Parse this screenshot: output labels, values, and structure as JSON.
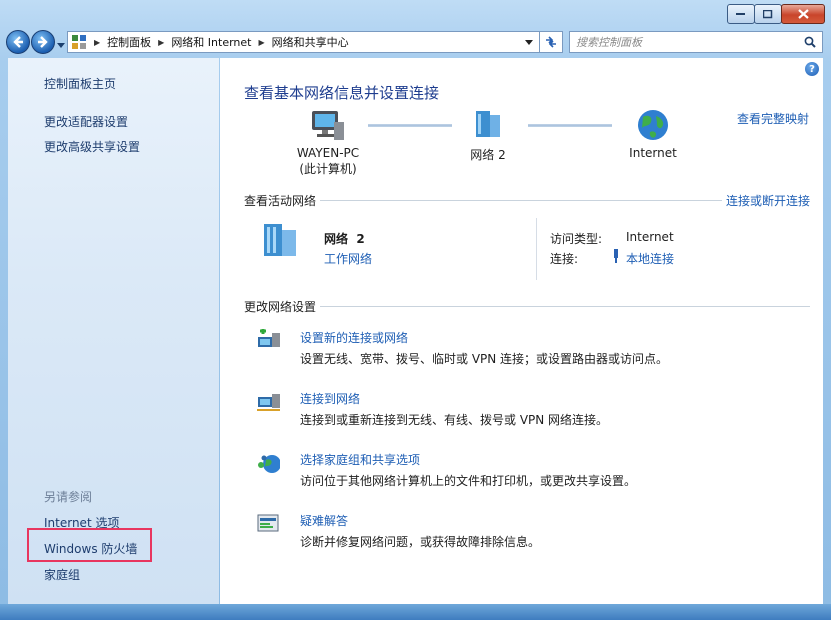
{
  "window": {
    "minimize_label": "Minimize",
    "maximize_label": "Maximize",
    "close_label": "Close"
  },
  "address": {
    "breadcrumbs": [
      "控制面板",
      "网络和 Internet",
      "网络和共享中心"
    ],
    "search_placeholder": "搜索控制面板"
  },
  "sidebar": {
    "items": [
      {
        "label": "控制面板主页"
      },
      {
        "label": "更改适配器设置"
      },
      {
        "label": "更改高级共享设置"
      }
    ],
    "see_also_heading": "另请参阅",
    "see_also": [
      {
        "label": "Internet 选项"
      },
      {
        "label": "Windows 防火墙"
      },
      {
        "label": "家庭组"
      }
    ]
  },
  "main": {
    "title": "查看基本网络信息并设置连接",
    "full_map_link": "查看完整映射",
    "map": {
      "computer_name": "WAYEN-PC",
      "computer_sub": "(此计算机)",
      "network_name": "网络  2",
      "internet_name": "Internet"
    },
    "active_section": {
      "heading": "查看活动网络",
      "link": "连接或断开连接",
      "network_name": "网络  2",
      "network_type": "工作网络",
      "access_type_label": "访问类型:",
      "access_type_value": "Internet",
      "connections_label": "连接:",
      "connections_value": "本地连接"
    },
    "change_section": {
      "heading": "更改网络设置",
      "tasks": [
        {
          "title": "设置新的连接或网络",
          "desc": "设置无线、宽带、拨号、临时或 VPN 连接；或设置路由器或访问点。",
          "icon": "new-connection-icon"
        },
        {
          "title": "连接到网络",
          "desc": "连接到或重新连接到无线、有线、拨号或 VPN 网络连接。",
          "icon": "connect-network-icon"
        },
        {
          "title": "选择家庭组和共享选项",
          "desc": "访问位于其他网络计算机上的文件和打印机，或更改共享设置。",
          "icon": "homegroup-icon"
        },
        {
          "title": "疑难解答",
          "desc": "诊断并修复网络问题，或获得故障排除信息。",
          "icon": "troubleshoot-icon"
        }
      ]
    }
  },
  "colors": {
    "link": "#1e5eb4",
    "title": "#1e3d8f",
    "highlight_box": "#e8365f"
  }
}
